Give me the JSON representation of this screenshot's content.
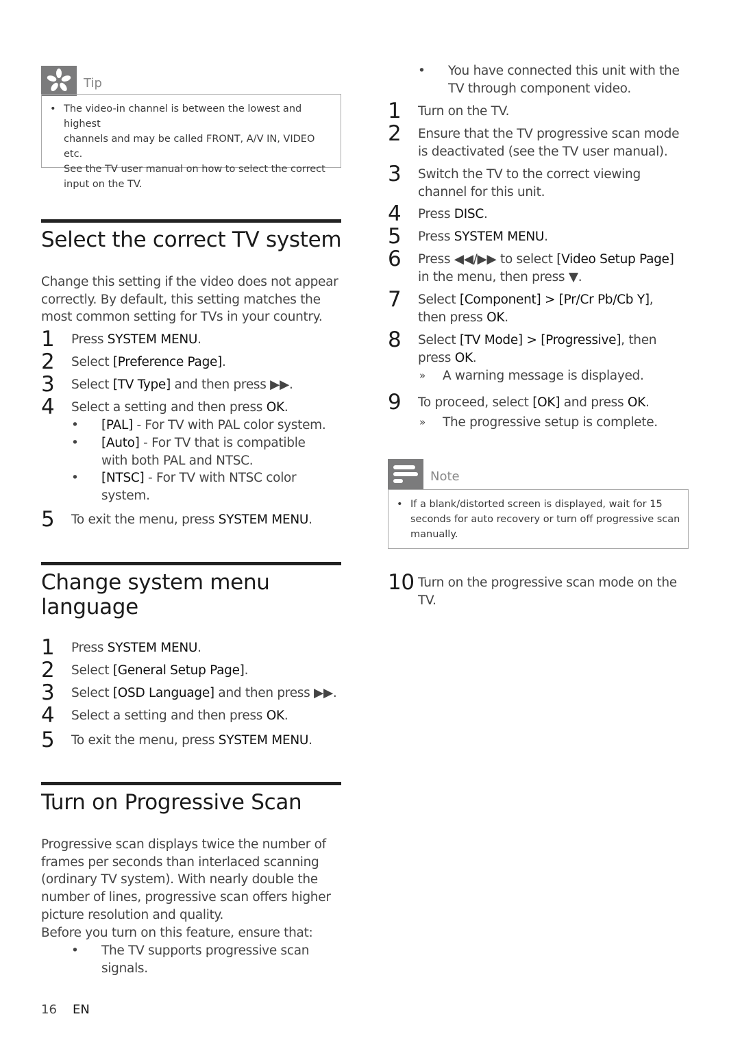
{
  "tip": {
    "title": "Tip",
    "icon": "asterisk-icon",
    "bullet": "The video-in channel is between the lowest and highest channels and may be called FRONT, A/V IN, VIDEO etc. See the TV user manual on how to select the correct input on the TV.",
    "lines": [
      "The video-in channel is between the lowest and highest",
      "channels and may be called FRONT, A/V IN, VIDEO etc.",
      "See the TV user manual on how to select the correct",
      "input on the TV."
    ]
  },
  "section_tv_system": {
    "title": "Select the correct TV system",
    "intro_lines": [
      "Change this setting if the video does not appear",
      "correctly. By default, this setting matches the",
      "most common setting for TVs in your country."
    ],
    "steps": [
      {
        "num": "1",
        "pre": "Press ",
        "key": "SYSTEM MENU",
        "post": "."
      },
      {
        "num": "2",
        "pre": "Select ",
        "key": "[Preference Page]",
        "post": "."
      },
      {
        "num": "3",
        "pre": "Select ",
        "key": "[TV Type]",
        "post": " and then press ▶▶."
      },
      {
        "num": "4",
        "pre": "Select a setting and then press ",
        "key": "OK",
        "post": "."
      },
      {
        "num": "5",
        "pre": "To exit the menu, press ",
        "key": "SYSTEM MENU",
        "post": "."
      }
    ],
    "options": [
      {
        "key": "[PAL]",
        "line1": " - For TV with PAL color system.",
        "line2": ""
      },
      {
        "key": "[Auto]",
        "line1": " - For TV that is compatible",
        "line2": "with both PAL and NTSC."
      },
      {
        "key": "[NTSC]",
        "line1": " - For TV with NTSC color",
        "line2": "system."
      }
    ]
  },
  "section_language": {
    "title_line1": "Change system menu",
    "title_line2": "language",
    "steps": [
      {
        "num": "1",
        "pre": "Press ",
        "key": "SYSTEM MENU",
        "post": "."
      },
      {
        "num": "2",
        "pre": "Select ",
        "key": "[General Setup Page]",
        "post": "."
      },
      {
        "num": "3",
        "pre": "Select ",
        "key": "[OSD Language]",
        "post": " and then press ▶▶."
      },
      {
        "num": "4",
        "pre": "Select a setting and then press ",
        "key": "OK",
        "post": "."
      },
      {
        "num": "5",
        "pre": "To exit the menu, press ",
        "key": "SYSTEM MENU",
        "post": "."
      }
    ]
  },
  "section_progressive": {
    "title": "Turn on Progressive Scan",
    "intro_lines": [
      "Progressive scan displays twice the number of",
      "frames per seconds than interlaced scanning",
      "(ordinary TV system). With nearly double the",
      "number of lines, progressive scan offers higher",
      "picture resolution and quality.",
      "Before you turn on this feature, ensure that:"
    ],
    "prereqs": [
      {
        "line1": "The TV supports progressive scan",
        "line2": "signals."
      },
      {
        "line1": "You have connected this unit with the",
        "line2": "TV through component video."
      }
    ],
    "steps": [
      {
        "num": "1",
        "lines": [
          {
            "pre": "Turn on the TV.",
            "key": "",
            "post": ""
          }
        ]
      },
      {
        "num": "2",
        "lines": [
          {
            "pre": "Ensure that the TV progressive scan mode",
            "key": "",
            "post": ""
          },
          {
            "pre": "is deactivated (see the TV user manual).",
            "key": "",
            "post": ""
          }
        ]
      },
      {
        "num": "3",
        "lines": [
          {
            "pre": "Switch the TV to the correct viewing",
            "key": "",
            "post": ""
          },
          {
            "pre": "channel for this unit.",
            "key": "",
            "post": ""
          }
        ]
      },
      {
        "num": "4",
        "lines": [
          {
            "pre": "Press ",
            "key": "DISC",
            "post": "."
          }
        ]
      },
      {
        "num": "5",
        "lines": [
          {
            "pre": "Press ",
            "key": "SYSTEM MENU",
            "post": "."
          }
        ]
      },
      {
        "num": "6",
        "lines": [
          {
            "pre": "Press ◀◀/▶▶ to select ",
            "key": "[Video Setup Page]",
            "post": ""
          },
          {
            "pre": "in the menu, then press ▼.",
            "key": "",
            "post": ""
          }
        ]
      },
      {
        "num": "7",
        "lines": [
          {
            "pre": "Select ",
            "key": "[Component] > [Pr/Cr Pb/Cb Y]",
            "post": ","
          },
          {
            "pre": "then press ",
            "key": "OK",
            "post": "."
          }
        ]
      },
      {
        "num": "8",
        "lines": [
          {
            "pre": "Select ",
            "key": "[TV Mode] > [Progressive]",
            "post": ", then"
          },
          {
            "pre": "press ",
            "key": "OK",
            "post": "."
          }
        ],
        "result": "A warning message is displayed."
      },
      {
        "num": "9",
        "lines": [
          {
            "pre": "To proceed, select ",
            "key": "[OK]",
            "post": " and press "
          }
        ],
        "key2": "OK",
        "post2": ".",
        "result": "The progressive setup is complete."
      },
      {
        "num": "10",
        "lines": [
          {
            "pre": "Turn on the progressive scan mode on the",
            "key": "",
            "post": ""
          },
          {
            "pre": "TV.",
            "key": "",
            "post": ""
          }
        ]
      }
    ],
    "result_marker": "»"
  },
  "note": {
    "title": "Note",
    "icon": "note-lines-icon",
    "lines": [
      "If a blank/distorted screen is displayed, wait for 15",
      "seconds for auto recovery or turn off progressive scan",
      "manually."
    ]
  },
  "footer": {
    "page_number": "16",
    "language": "EN"
  },
  "bullet_glyph": "•"
}
